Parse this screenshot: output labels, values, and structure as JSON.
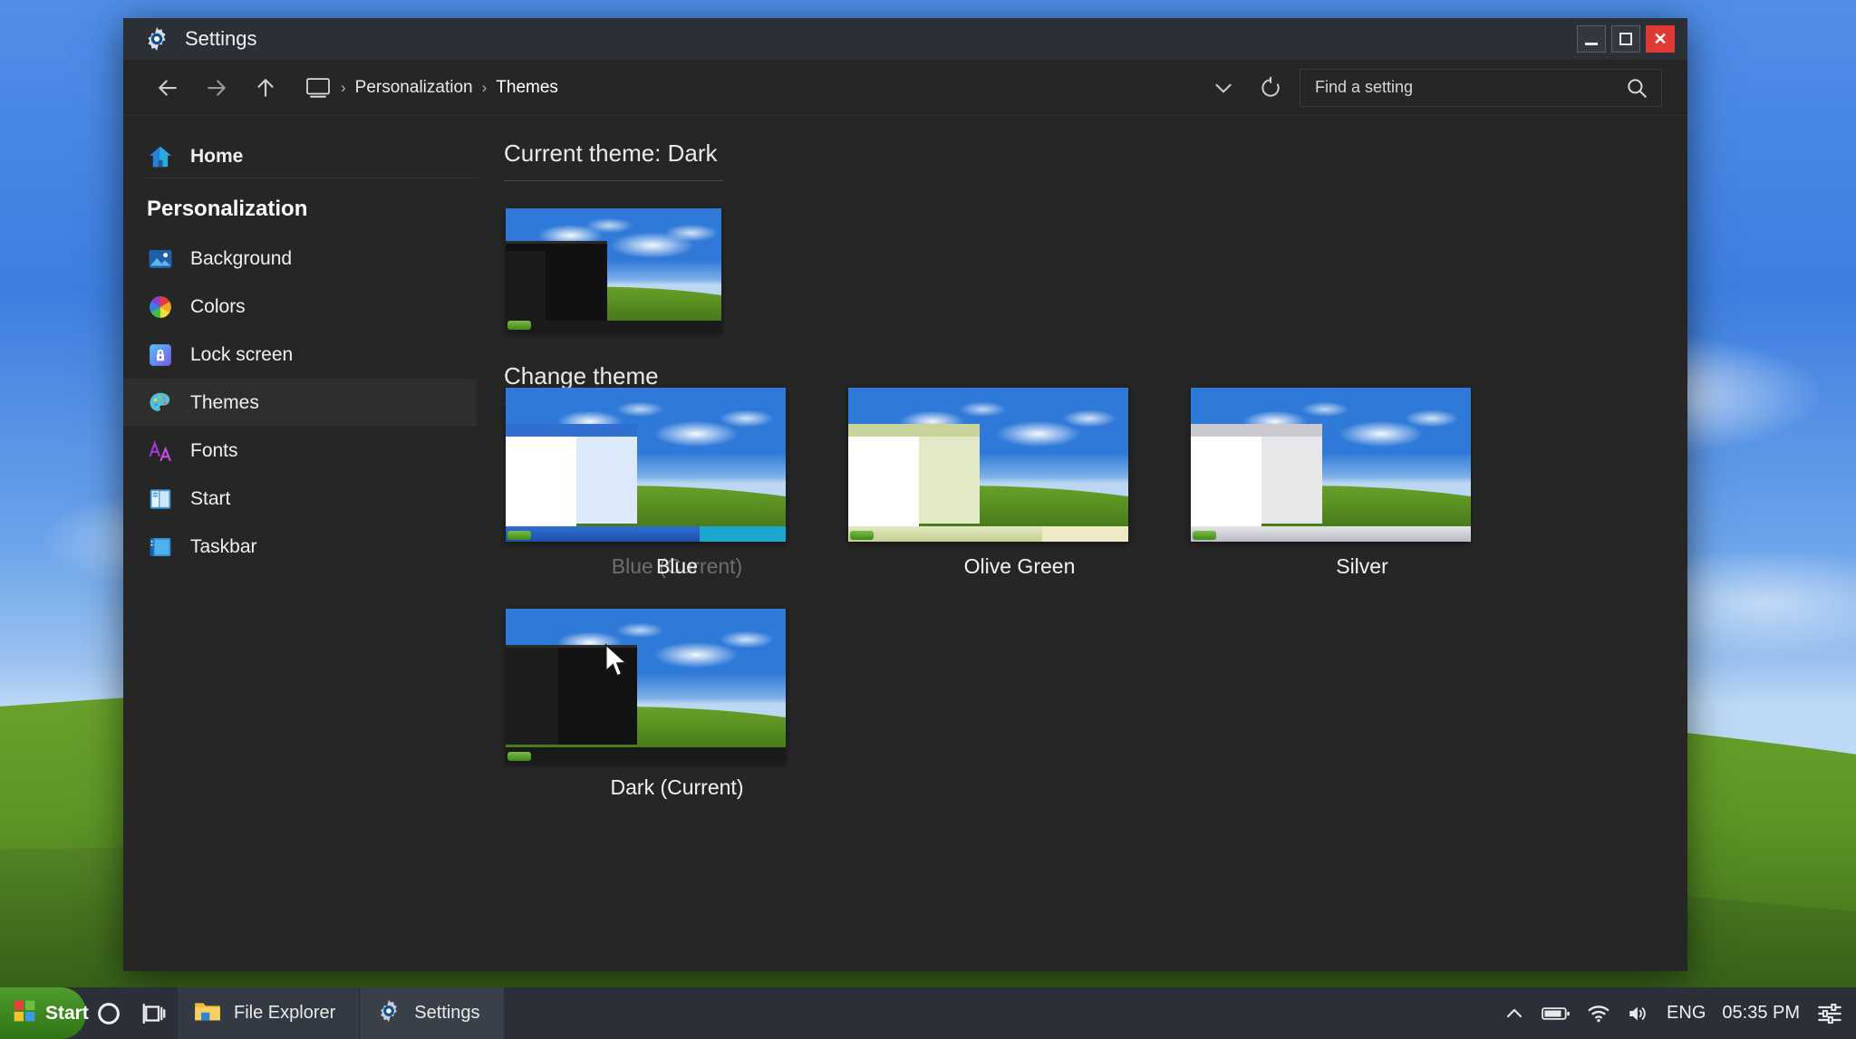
{
  "window": {
    "title": "Settings",
    "app_icon": "gear-icon",
    "buttons": {
      "minimize": "_",
      "maximize": "□",
      "close": "✕"
    }
  },
  "toolbar": {
    "back_icon": "arrow-left-icon",
    "forward_icon": "arrow-right-icon",
    "up_icon": "arrow-up-icon",
    "device_icon": "monitor-icon",
    "breadcrumb": [
      "Personalization",
      "Themes"
    ],
    "separator": "›",
    "history_icon": "chevron-down-icon",
    "refresh_icon": "refresh-icon",
    "search_placeholder": "Find a setting",
    "search_value": "",
    "search_icon": "search-icon"
  },
  "sidebar": {
    "home": {
      "label": "Home",
      "icon": "home-icon"
    },
    "group_title": "Personalization",
    "items": [
      {
        "label": "Background",
        "icon": "image-icon",
        "selected": false
      },
      {
        "label": "Colors",
        "icon": "color-wheel-icon",
        "selected": false
      },
      {
        "label": "Lock screen",
        "icon": "lock-icon",
        "selected": false
      },
      {
        "label": "Themes",
        "icon": "palette-icon",
        "selected": true
      },
      {
        "label": "Fonts",
        "icon": "fonts-icon",
        "selected": false
      },
      {
        "label": "Start",
        "icon": "start-icon",
        "selected": false
      },
      {
        "label": "Taskbar",
        "icon": "taskbar-icon",
        "selected": false
      }
    ]
  },
  "content": {
    "current_theme_heading": "Current theme: Dark",
    "change_theme_heading": "Change theme",
    "themes": [
      {
        "label": "Blue",
        "ghost_label": "Blue (Current)",
        "style": "blue"
      },
      {
        "label": "Olive Green",
        "ghost_label": "",
        "style": "olive"
      },
      {
        "label": "Silver",
        "ghost_label": "",
        "style": "silver"
      },
      {
        "label": "Dark (Current)",
        "ghost_label": "",
        "style": "dark"
      }
    ]
  },
  "taskbar": {
    "start_label": "Start",
    "start_icon": "windows-logo-icon",
    "cortana_icon": "circle-icon",
    "taskview_icon": "task-view-icon",
    "tasks": [
      {
        "label": "File Explorer",
        "icon": "folder-icon"
      },
      {
        "label": "Settings",
        "icon": "gear-icon"
      }
    ],
    "tray": {
      "overflow_icon": "chevron-up-icon",
      "battery_icon": "battery-icon",
      "wifi_icon": "wifi-icon",
      "volume_icon": "speaker-icon",
      "language": "ENG",
      "time": "05:35 PM",
      "action_center_icon": "sliders-icon"
    }
  },
  "colors": {
    "window_bg": "#262626",
    "titlebar_bg": "#2b2f36",
    "accent_close": "#e03a34",
    "taskbar_bg": "#2b3038",
    "start_green": "#3f8a22",
    "text_primary": "#f0f0f0"
  }
}
